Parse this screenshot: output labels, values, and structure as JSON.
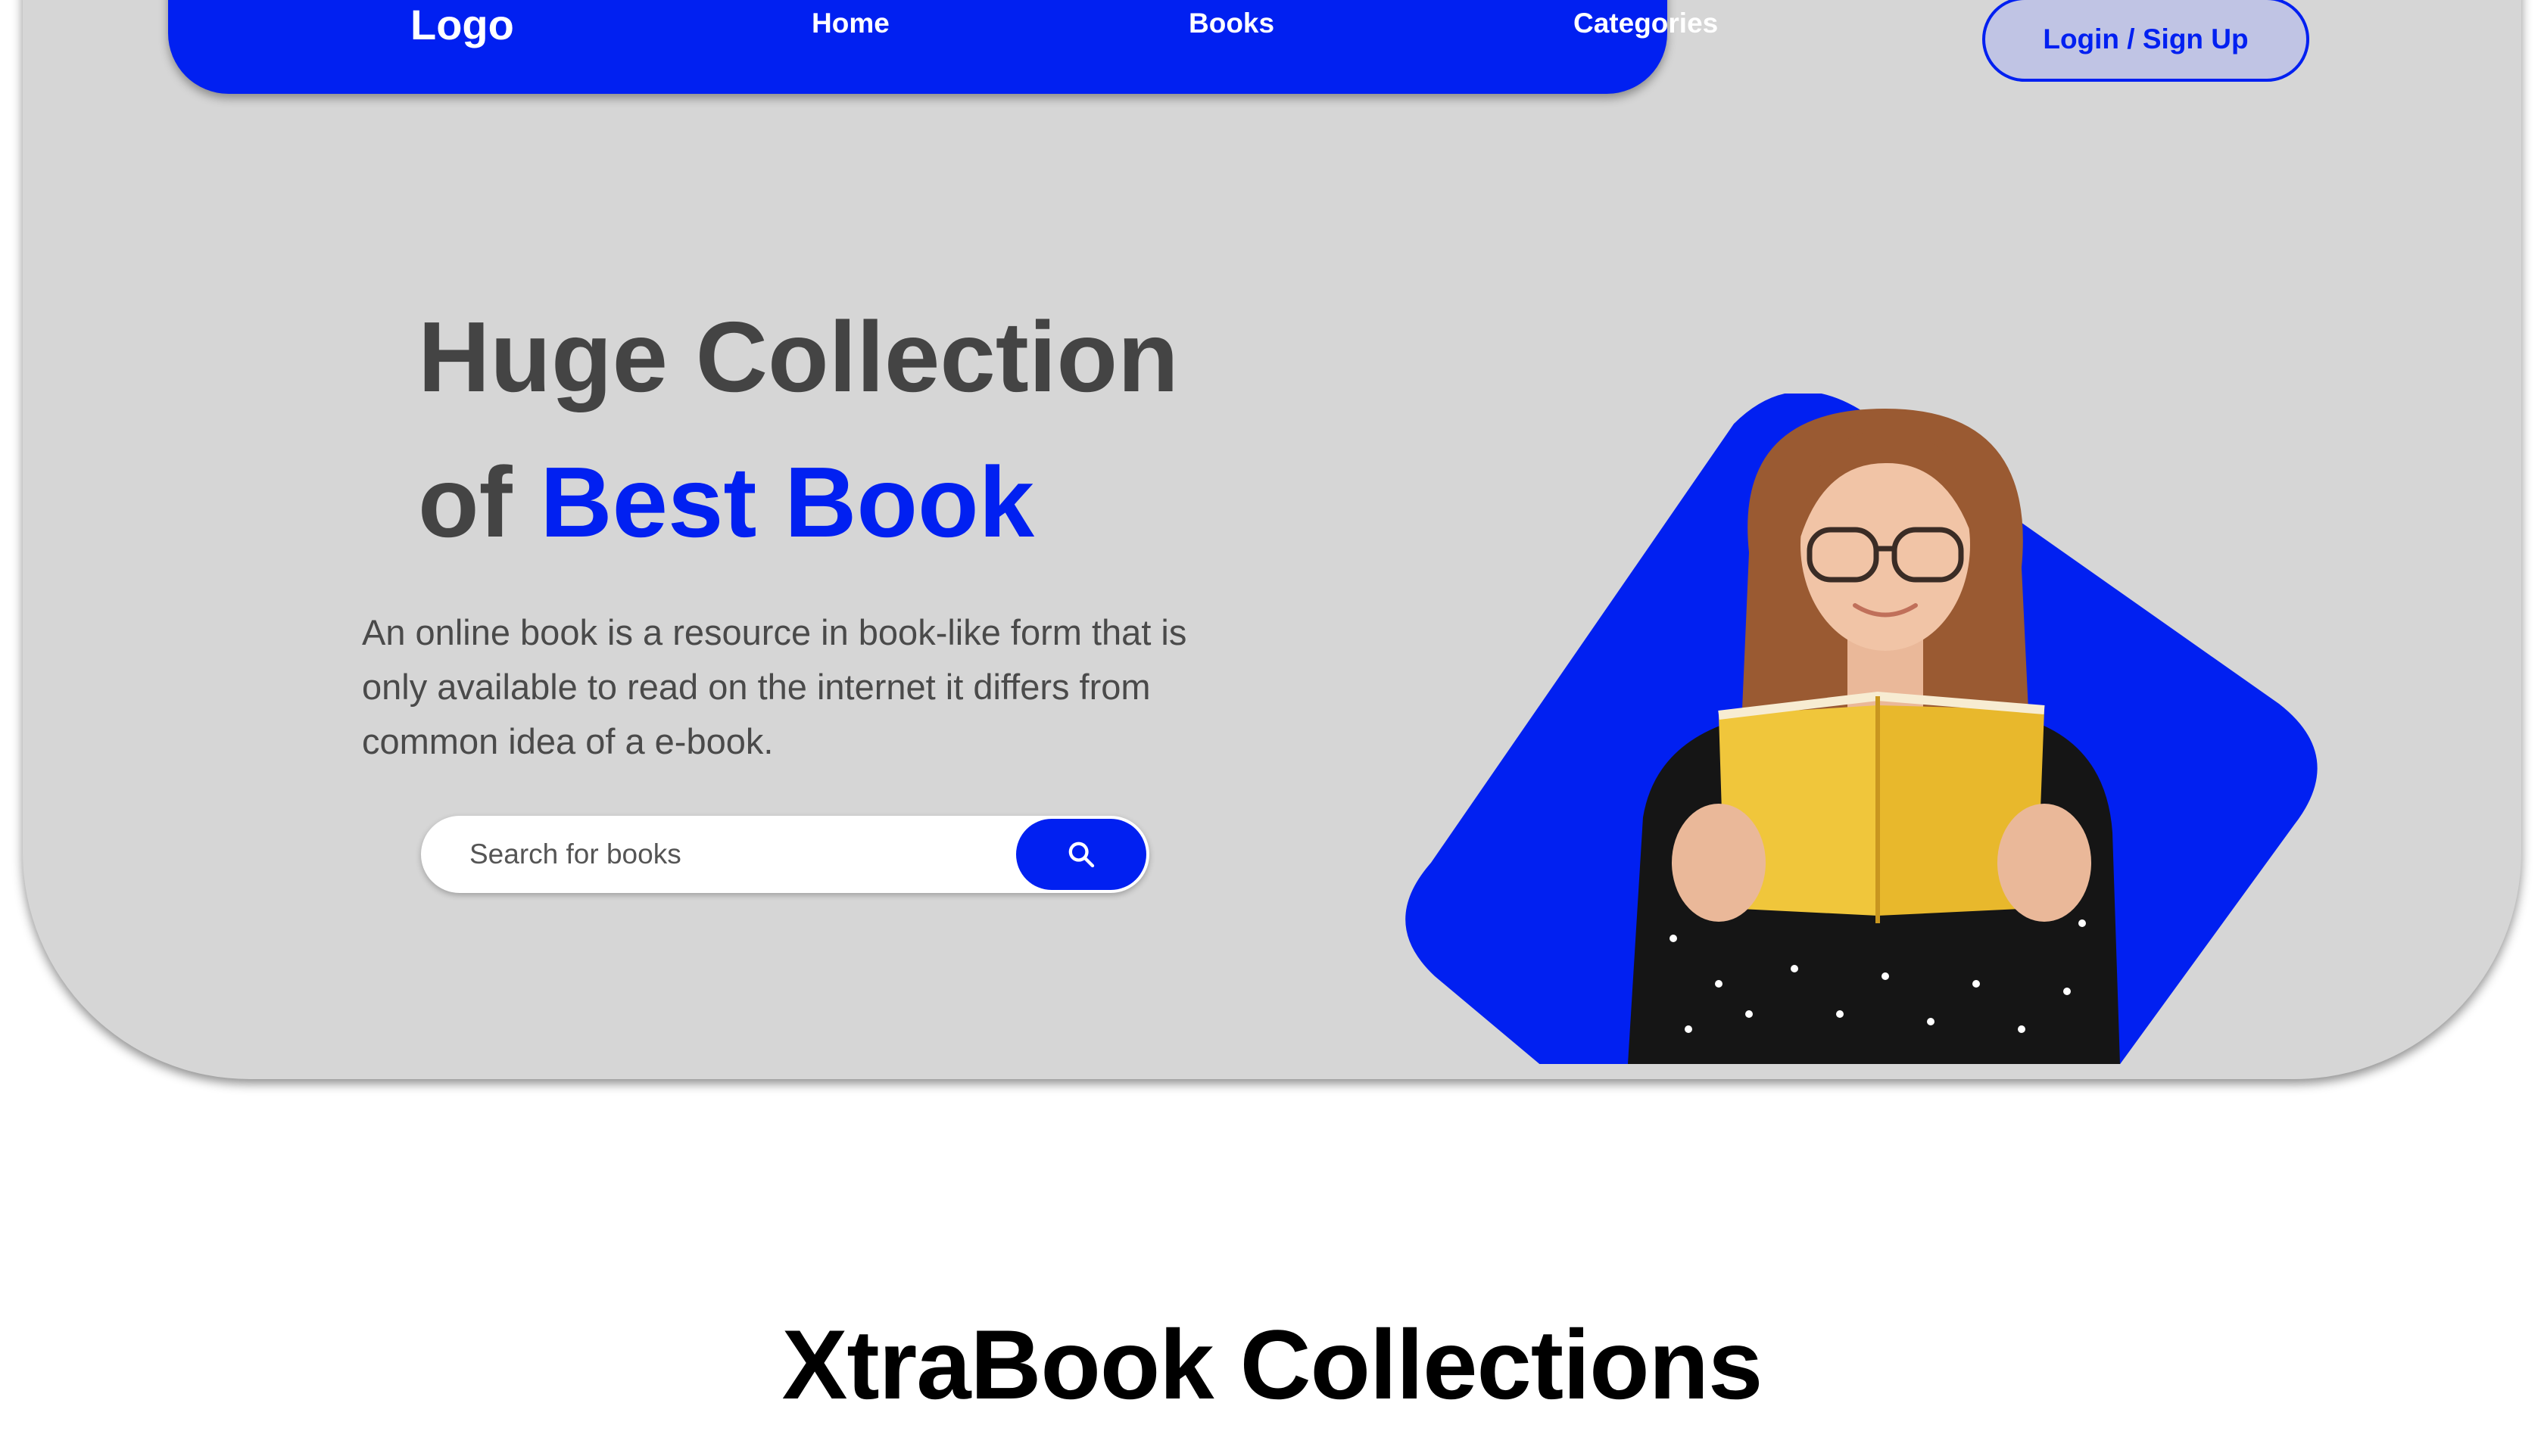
{
  "nav": {
    "logo": "Logo",
    "links": [
      "Home",
      "Books",
      "Categories"
    ],
    "login": "Login / Sign Up"
  },
  "hero": {
    "headline_line1": "Huge Collection",
    "headline_of": "of ",
    "headline_accent": "Best Book",
    "description": "An online book is a resource in book-like form that is only available to read on the internet it differs from common idea of a e-book.",
    "search_placeholder": "Search for books"
  },
  "section": {
    "title_light": "Xtra",
    "title_bold": "Book Collections"
  },
  "colors": {
    "accent": "#0120f1",
    "hero_bg": "#d6d6d6",
    "book": "#f0c63b"
  },
  "icons": [
    "search-icon"
  ]
}
